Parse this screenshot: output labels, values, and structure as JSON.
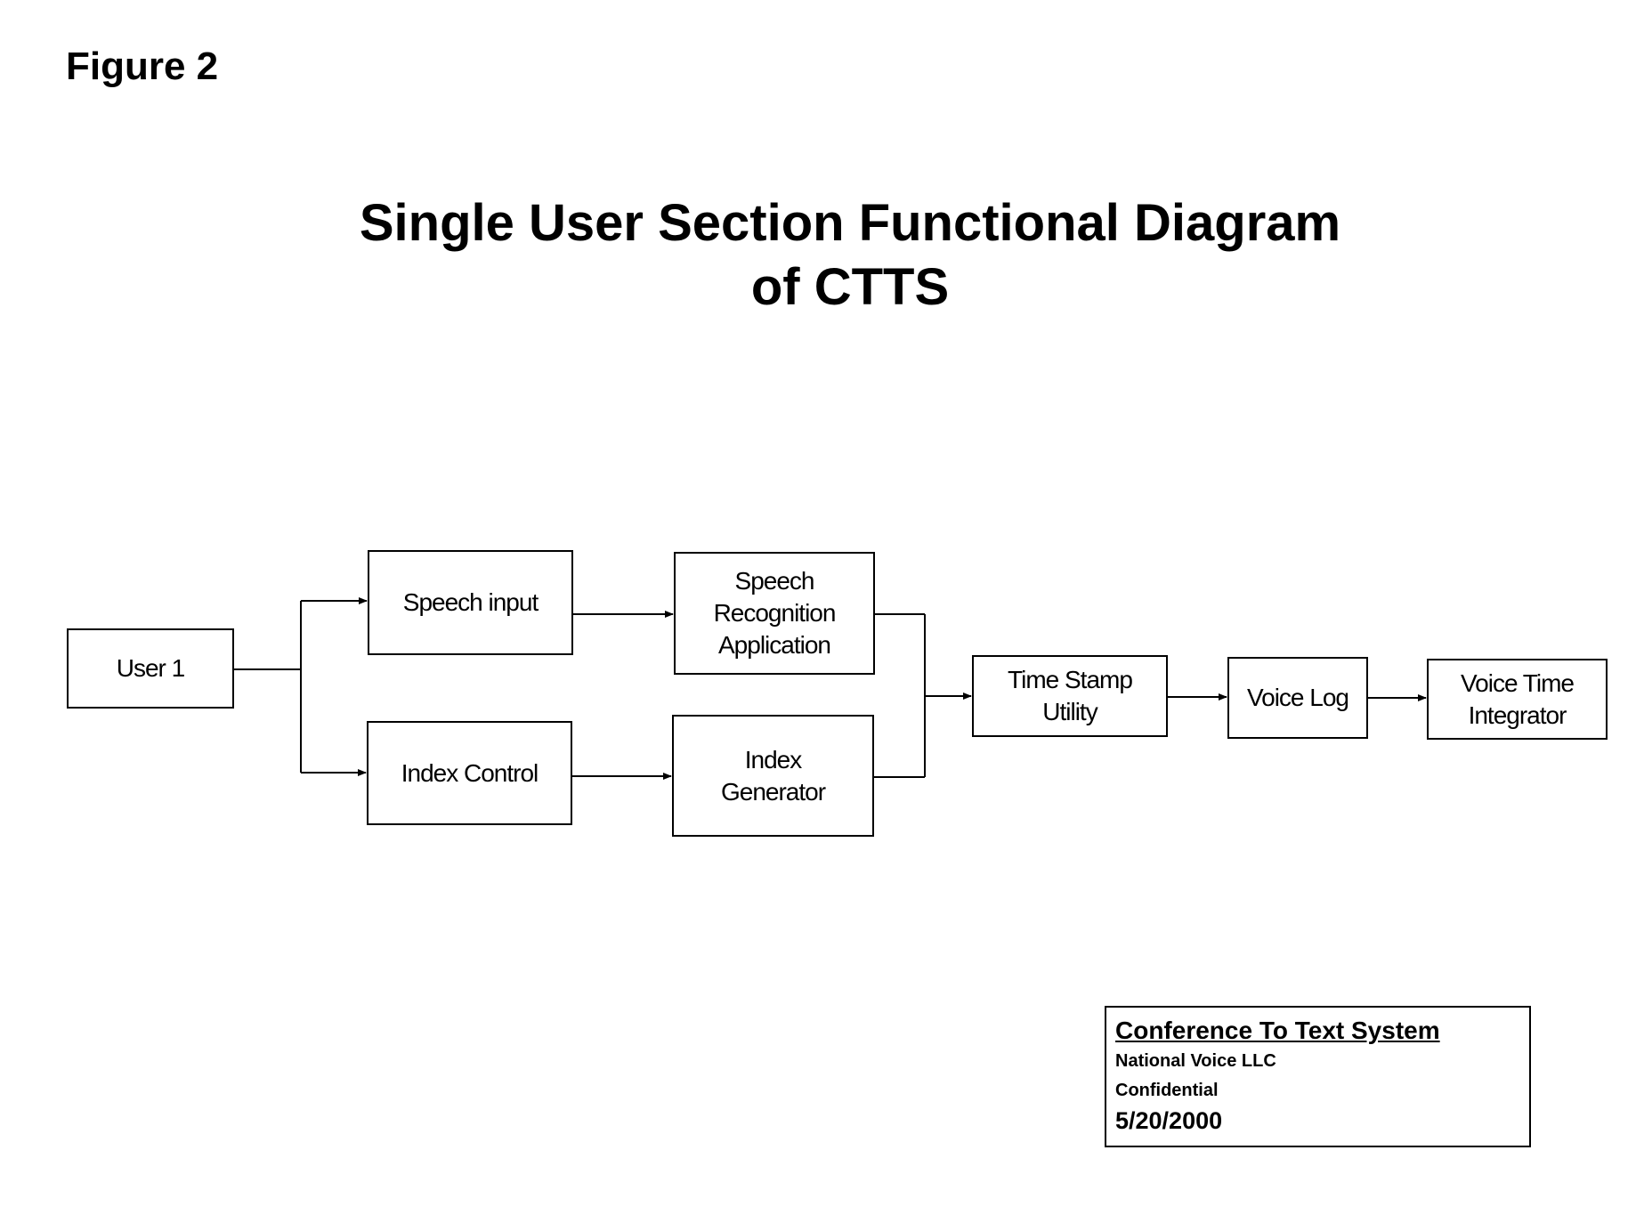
{
  "figure_label": "Figure 2",
  "title": {
    "line1": "Single User Section Functional Diagram",
    "line2": "of CTTS"
  },
  "nodes": {
    "user1": "User 1",
    "speech_input": "Speech input",
    "index_control": "Index Control",
    "speech_recognition": "Speech Recognition Application",
    "index_generator": "Index Generator",
    "time_stamp": "Time Stamp Utility",
    "voice_log": "Voice Log",
    "voice_time_integrator": "Voice Time Integrator"
  },
  "edges": [
    {
      "from": "User 1",
      "to": "Speech input"
    },
    {
      "from": "User 1",
      "to": "Index Control"
    },
    {
      "from": "Speech input",
      "to": "Speech Recognition Application"
    },
    {
      "from": "Index Control",
      "to": "Index Generator"
    },
    {
      "from": "Speech Recognition Application",
      "to": "Time Stamp Utility"
    },
    {
      "from": "Index Generator",
      "to": "Time Stamp Utility"
    },
    {
      "from": "Time Stamp Utility",
      "to": "Voice Log"
    },
    {
      "from": "Voice Log",
      "to": "Voice Time Integrator"
    }
  ],
  "footer": {
    "title": "Conference To Text System",
    "company": "National Voice LLC",
    "classification": "Confidential",
    "date": "5/20/2000"
  }
}
